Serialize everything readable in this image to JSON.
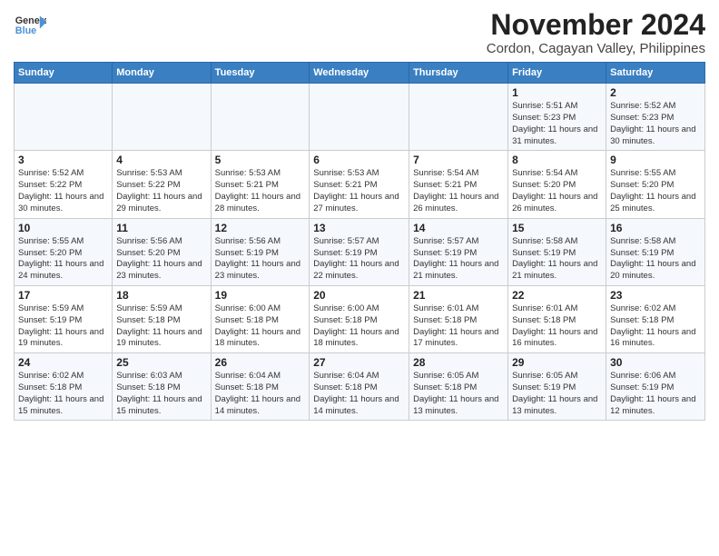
{
  "header": {
    "logo_line1": "General",
    "logo_line2": "Blue",
    "title": "November 2024",
    "subtitle": "Cordon, Cagayan Valley, Philippines"
  },
  "days_of_week": [
    "Sunday",
    "Monday",
    "Tuesday",
    "Wednesday",
    "Thursday",
    "Friday",
    "Saturday"
  ],
  "weeks": [
    [
      {
        "day": "",
        "info": ""
      },
      {
        "day": "",
        "info": ""
      },
      {
        "day": "",
        "info": ""
      },
      {
        "day": "",
        "info": ""
      },
      {
        "day": "",
        "info": ""
      },
      {
        "day": "1",
        "info": "Sunrise: 5:51 AM\nSunset: 5:23 PM\nDaylight: 11 hours and 31 minutes."
      },
      {
        "day": "2",
        "info": "Sunrise: 5:52 AM\nSunset: 5:23 PM\nDaylight: 11 hours and 30 minutes."
      }
    ],
    [
      {
        "day": "3",
        "info": "Sunrise: 5:52 AM\nSunset: 5:22 PM\nDaylight: 11 hours and 30 minutes."
      },
      {
        "day": "4",
        "info": "Sunrise: 5:53 AM\nSunset: 5:22 PM\nDaylight: 11 hours and 29 minutes."
      },
      {
        "day": "5",
        "info": "Sunrise: 5:53 AM\nSunset: 5:21 PM\nDaylight: 11 hours and 28 minutes."
      },
      {
        "day": "6",
        "info": "Sunrise: 5:53 AM\nSunset: 5:21 PM\nDaylight: 11 hours and 27 minutes."
      },
      {
        "day": "7",
        "info": "Sunrise: 5:54 AM\nSunset: 5:21 PM\nDaylight: 11 hours and 26 minutes."
      },
      {
        "day": "8",
        "info": "Sunrise: 5:54 AM\nSunset: 5:20 PM\nDaylight: 11 hours and 26 minutes."
      },
      {
        "day": "9",
        "info": "Sunrise: 5:55 AM\nSunset: 5:20 PM\nDaylight: 11 hours and 25 minutes."
      }
    ],
    [
      {
        "day": "10",
        "info": "Sunrise: 5:55 AM\nSunset: 5:20 PM\nDaylight: 11 hours and 24 minutes."
      },
      {
        "day": "11",
        "info": "Sunrise: 5:56 AM\nSunset: 5:20 PM\nDaylight: 11 hours and 23 minutes."
      },
      {
        "day": "12",
        "info": "Sunrise: 5:56 AM\nSunset: 5:19 PM\nDaylight: 11 hours and 23 minutes."
      },
      {
        "day": "13",
        "info": "Sunrise: 5:57 AM\nSunset: 5:19 PM\nDaylight: 11 hours and 22 minutes."
      },
      {
        "day": "14",
        "info": "Sunrise: 5:57 AM\nSunset: 5:19 PM\nDaylight: 11 hours and 21 minutes."
      },
      {
        "day": "15",
        "info": "Sunrise: 5:58 AM\nSunset: 5:19 PM\nDaylight: 11 hours and 21 minutes."
      },
      {
        "day": "16",
        "info": "Sunrise: 5:58 AM\nSunset: 5:19 PM\nDaylight: 11 hours and 20 minutes."
      }
    ],
    [
      {
        "day": "17",
        "info": "Sunrise: 5:59 AM\nSunset: 5:19 PM\nDaylight: 11 hours and 19 minutes."
      },
      {
        "day": "18",
        "info": "Sunrise: 5:59 AM\nSunset: 5:18 PM\nDaylight: 11 hours and 19 minutes."
      },
      {
        "day": "19",
        "info": "Sunrise: 6:00 AM\nSunset: 5:18 PM\nDaylight: 11 hours and 18 minutes."
      },
      {
        "day": "20",
        "info": "Sunrise: 6:00 AM\nSunset: 5:18 PM\nDaylight: 11 hours and 18 minutes."
      },
      {
        "day": "21",
        "info": "Sunrise: 6:01 AM\nSunset: 5:18 PM\nDaylight: 11 hours and 17 minutes."
      },
      {
        "day": "22",
        "info": "Sunrise: 6:01 AM\nSunset: 5:18 PM\nDaylight: 11 hours and 16 minutes."
      },
      {
        "day": "23",
        "info": "Sunrise: 6:02 AM\nSunset: 5:18 PM\nDaylight: 11 hours and 16 minutes."
      }
    ],
    [
      {
        "day": "24",
        "info": "Sunrise: 6:02 AM\nSunset: 5:18 PM\nDaylight: 11 hours and 15 minutes."
      },
      {
        "day": "25",
        "info": "Sunrise: 6:03 AM\nSunset: 5:18 PM\nDaylight: 11 hours and 15 minutes."
      },
      {
        "day": "26",
        "info": "Sunrise: 6:04 AM\nSunset: 5:18 PM\nDaylight: 11 hours and 14 minutes."
      },
      {
        "day": "27",
        "info": "Sunrise: 6:04 AM\nSunset: 5:18 PM\nDaylight: 11 hours and 14 minutes."
      },
      {
        "day": "28",
        "info": "Sunrise: 6:05 AM\nSunset: 5:18 PM\nDaylight: 11 hours and 13 minutes."
      },
      {
        "day": "29",
        "info": "Sunrise: 6:05 AM\nSunset: 5:19 PM\nDaylight: 11 hours and 13 minutes."
      },
      {
        "day": "30",
        "info": "Sunrise: 6:06 AM\nSunset: 5:19 PM\nDaylight: 11 hours and 12 minutes."
      }
    ]
  ]
}
